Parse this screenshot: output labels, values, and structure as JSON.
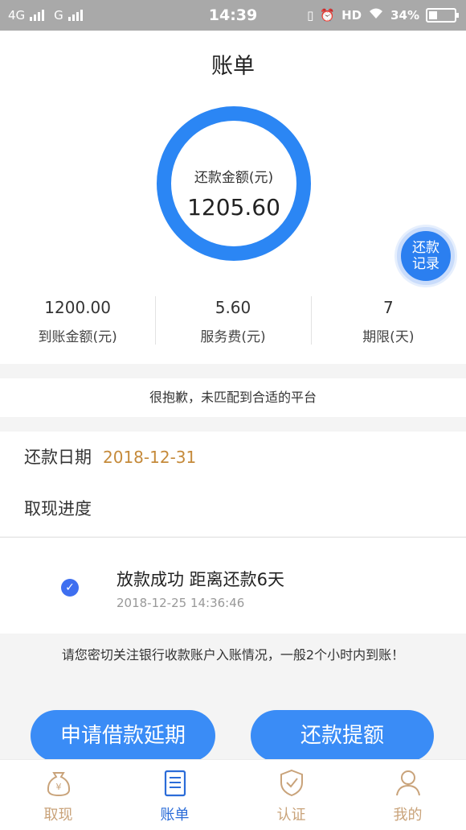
{
  "status_bar": {
    "signal1": "4G",
    "signal2": "G",
    "time": "14:39",
    "hd": "HD",
    "battery": "34%",
    "battery_level": 0.34
  },
  "page": {
    "title": "账单"
  },
  "summary": {
    "ring_label": "还款金额(元)",
    "ring_amount": "1205.60",
    "record_button": [
      "还款",
      "记录"
    ],
    "stats": [
      {
        "value": "1200.00",
        "label": "到账金额(元)"
      },
      {
        "value": "5.60",
        "label": "服务费(元)"
      },
      {
        "value": "7",
        "label": "期限(天)"
      }
    ]
  },
  "notice": "很抱歉，未匹配到合适的平台",
  "info": {
    "repay_date_label": "还款日期",
    "repay_date": "2018-12-31",
    "progress_label": "取现进度"
  },
  "progress": {
    "title": "放款成功 距离还款6天",
    "time": "2018-12-25 14:36:46"
  },
  "tip": "请您密切关注银行收款账户入账情况，一般2个小时内到账！",
  "buttons": {
    "extend": "申请借款延期",
    "repay": "还款提额"
  },
  "tabs": [
    {
      "label": "取现",
      "icon": "money-bag-icon"
    },
    {
      "label": "账单",
      "icon": "bill-icon",
      "active": true
    },
    {
      "label": "认证",
      "icon": "shield-check-icon"
    },
    {
      "label": "我的",
      "icon": "user-icon"
    }
  ],
  "colors": {
    "accent": "#2b86f4",
    "date": "#c58a3a",
    "tab_inactive": "#c9a37a",
    "tab_active": "#2b6cd8"
  }
}
